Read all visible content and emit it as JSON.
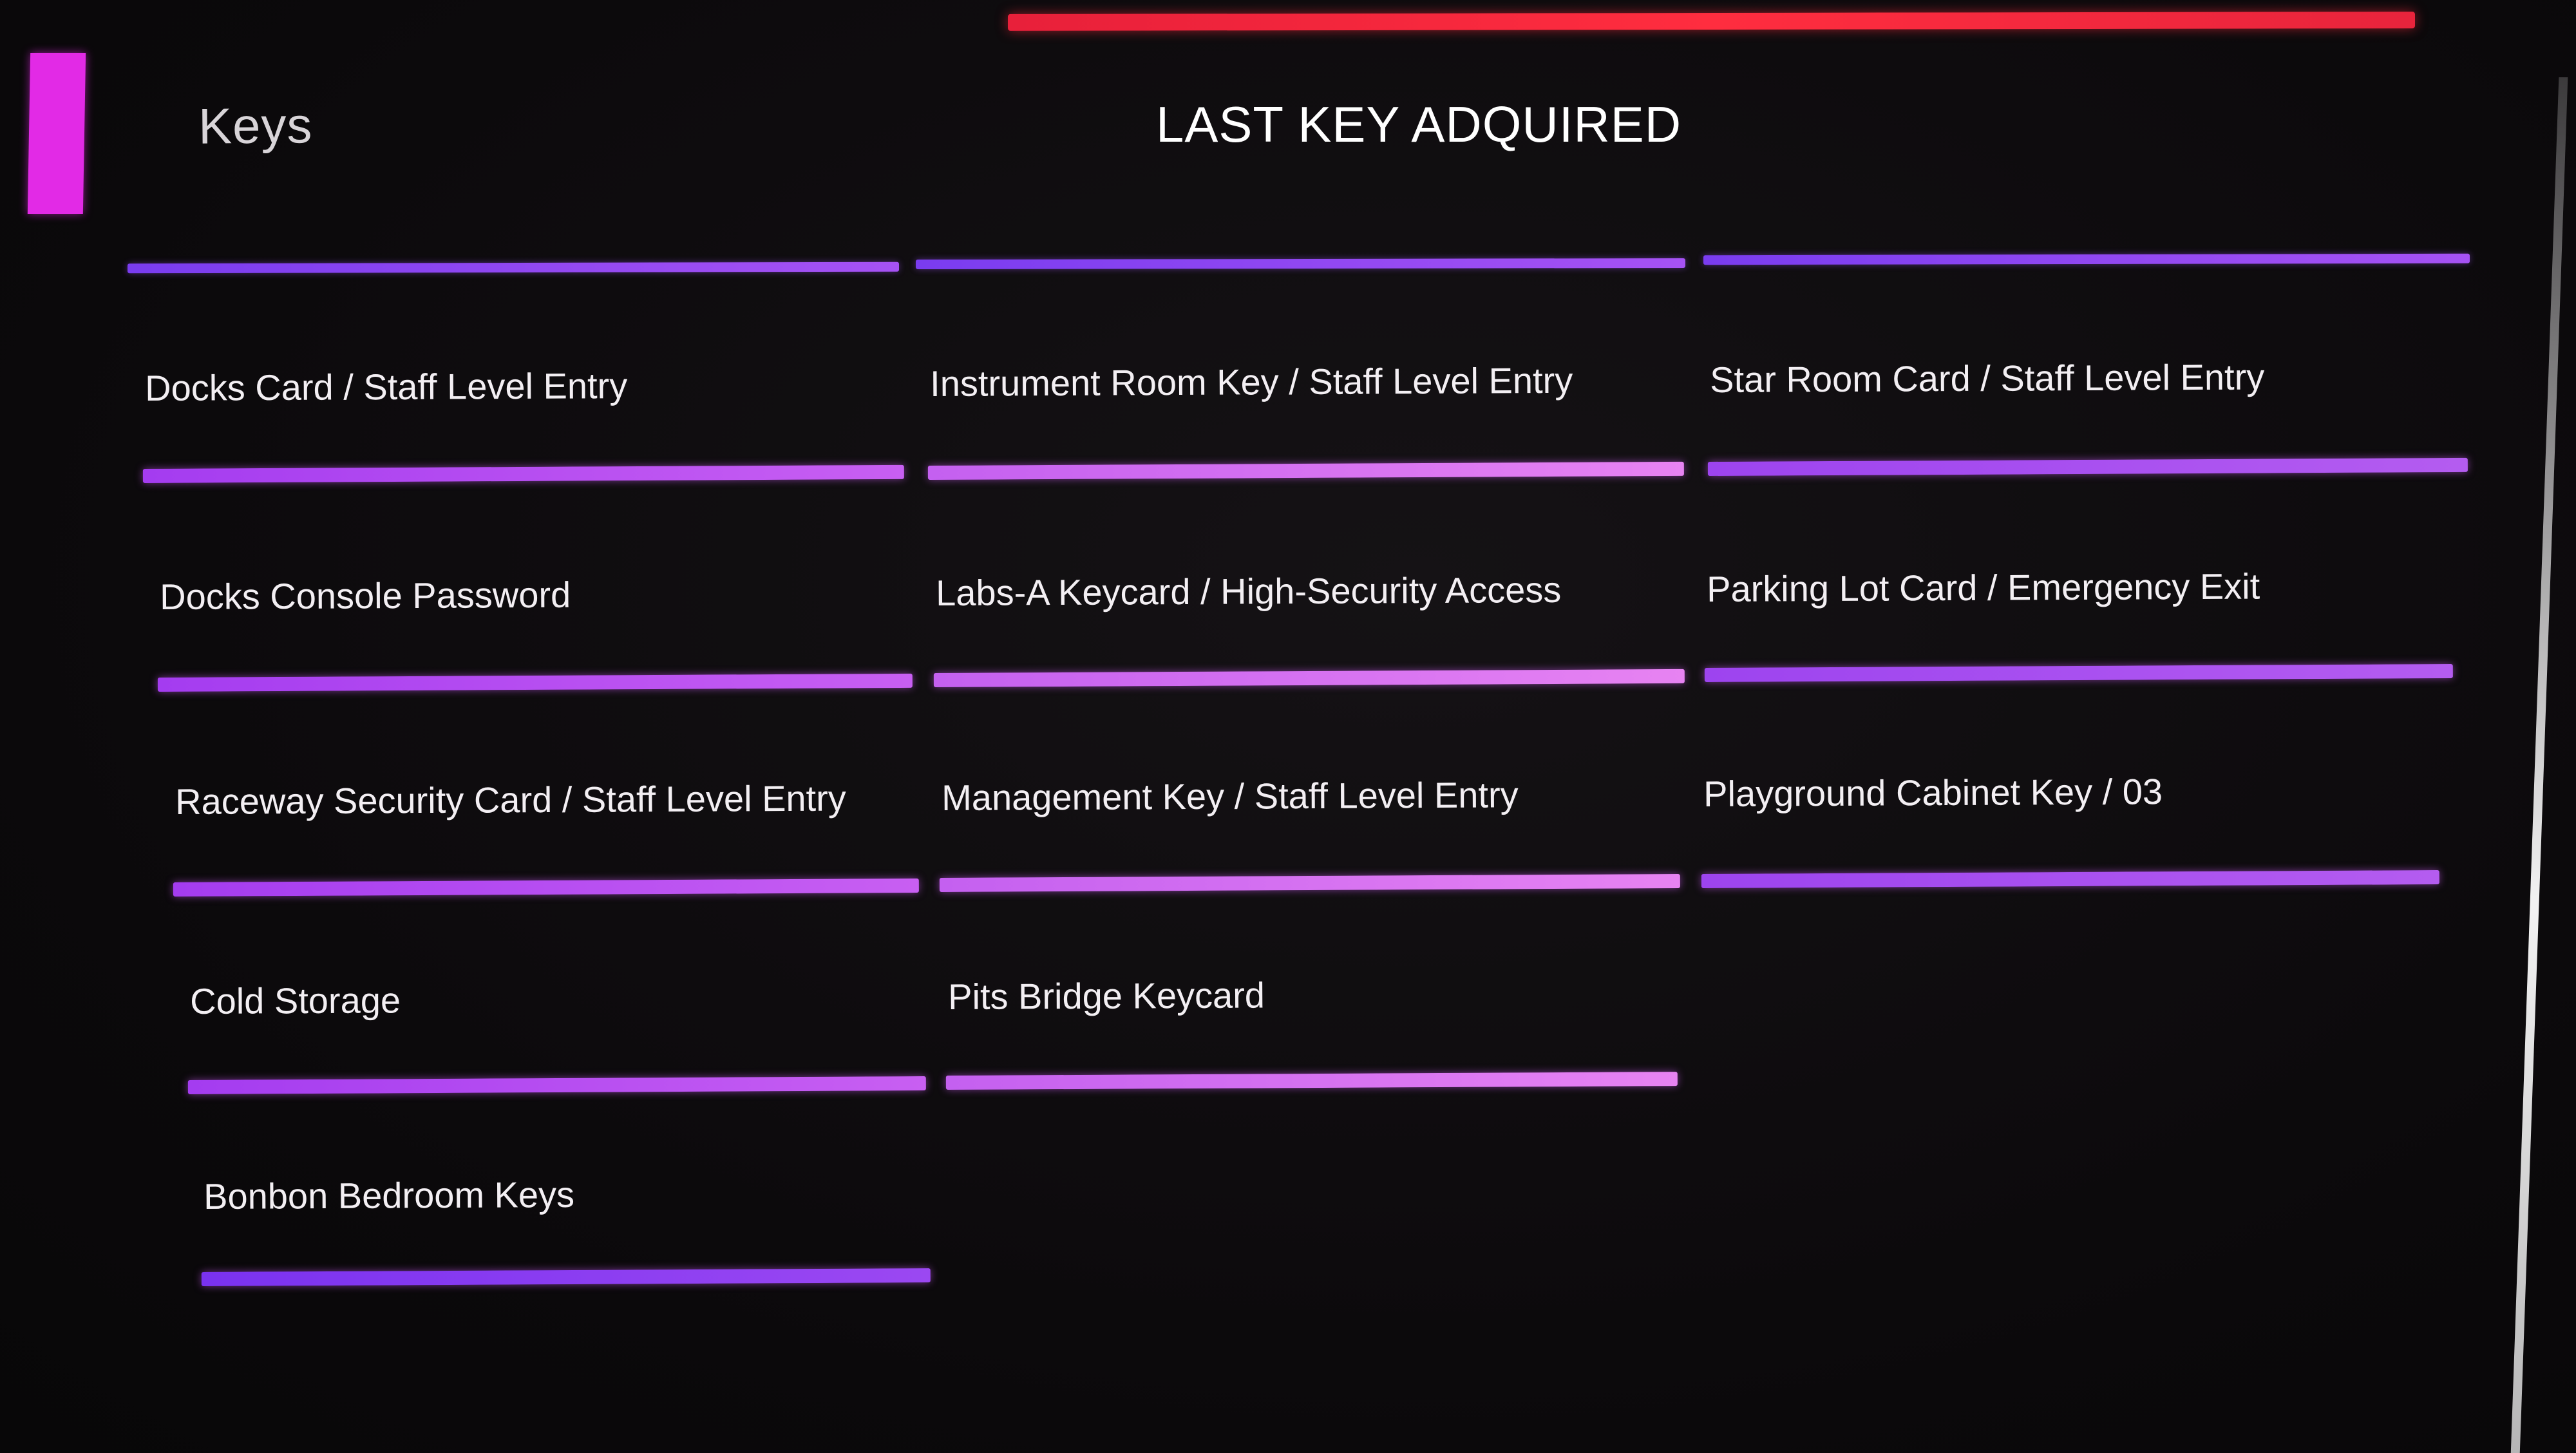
{
  "header": {
    "section_title": "Keys",
    "last_key_label": "LAST KEY ADQUIRED"
  },
  "keys": [
    {
      "label": "Docks Card / Staff Level Entry",
      "column": 0
    },
    {
      "label": "Instrument Room Key / Staff Level Entry",
      "column": 1
    },
    {
      "label": "Star Room Card / Staff Level Entry",
      "column": 2
    },
    {
      "label": "Docks Console Password",
      "column": 0
    },
    {
      "label": "Labs-A Keycard / High-Security Access",
      "column": 1
    },
    {
      "label": "Parking Lot Card / Emergency Exit",
      "column": 2
    },
    {
      "label": "Raceway Security Card / Staff Level Entry",
      "column": 0
    },
    {
      "label": "Management Key / Staff Level Entry",
      "column": 1
    },
    {
      "label": "Playground Cabinet Key / 03",
      "column": 2
    },
    {
      "label": "Cold Storage",
      "column": 0
    },
    {
      "label": "Pits Bridge Keycard",
      "column": 1
    },
    {
      "label": "Bonbon Bedroom Keys",
      "column": 0
    }
  ],
  "colors": {
    "accent_red": "#ff2d3f",
    "accent_magenta": "#e22ae6",
    "accent_violet": "#a652f4",
    "text": "#f3eff3",
    "background": "#0c0a0c"
  }
}
